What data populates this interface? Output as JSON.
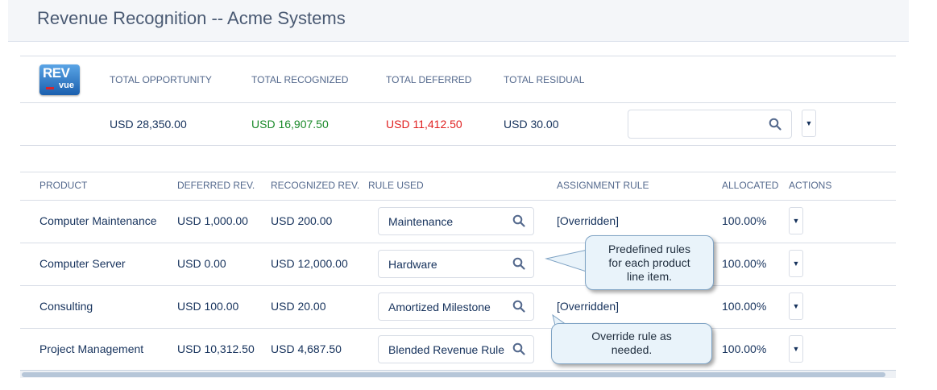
{
  "page_title": "Revenue Recognition -- Acme Systems",
  "logo": {
    "line1": "REV",
    "line2": "vue"
  },
  "totals": {
    "labels": [
      "TOTAL OPPORTUNITY",
      "TOTAL RECOGNIZED",
      "TOTAL DEFERRED",
      "TOTAL RESIDUAL"
    ],
    "opportunity": "USD 28,350.00",
    "recognized": "USD 16,907.50",
    "deferred": "USD 11,412.50",
    "residual": "USD 30.00"
  },
  "search": {
    "placeholder": "",
    "icon": "search-icon"
  },
  "menu_glyph": "▼",
  "columns": [
    "PRODUCT",
    "DEFERRED REV.",
    "RECOGNIZED REV.",
    "RULE USED",
    "ASSIGNMENT RULE",
    "ALLOCATED",
    "ACTIONS"
  ],
  "rows": [
    {
      "product": "Computer Maintenance",
      "deferred": "USD 1,000.00",
      "recognized": "USD 200.00",
      "rule": "Maintenance",
      "assignment": "[Overridden]",
      "allocated": "100.00%"
    },
    {
      "product": "Computer Server",
      "deferred": "USD 0.00",
      "recognized": "USD 12,000.00",
      "rule": "Hardware",
      "assignment": "",
      "allocated": "100.00%"
    },
    {
      "product": "Consulting",
      "deferred": "USD 100.00",
      "recognized": "USD 20.00",
      "rule": "Amortized Milestone",
      "assignment": "[Overridden]",
      "allocated": "100.00%"
    },
    {
      "product": "Project Management",
      "deferred": "USD 10,312.50",
      "recognized": "USD 4,687.50",
      "rule": "Blended Revenue Rule",
      "assignment": "",
      "allocated": "100.00%"
    }
  ],
  "callouts": {
    "predefined": {
      "line1": "Predefined rules",
      "line2": "for each product",
      "line3": "line item."
    },
    "override": {
      "line1": "Override rule as",
      "line2": "needed."
    }
  },
  "colors": {
    "recognized": "#1a8a2a",
    "deferred": "#e02020",
    "accent": "#16325c"
  }
}
